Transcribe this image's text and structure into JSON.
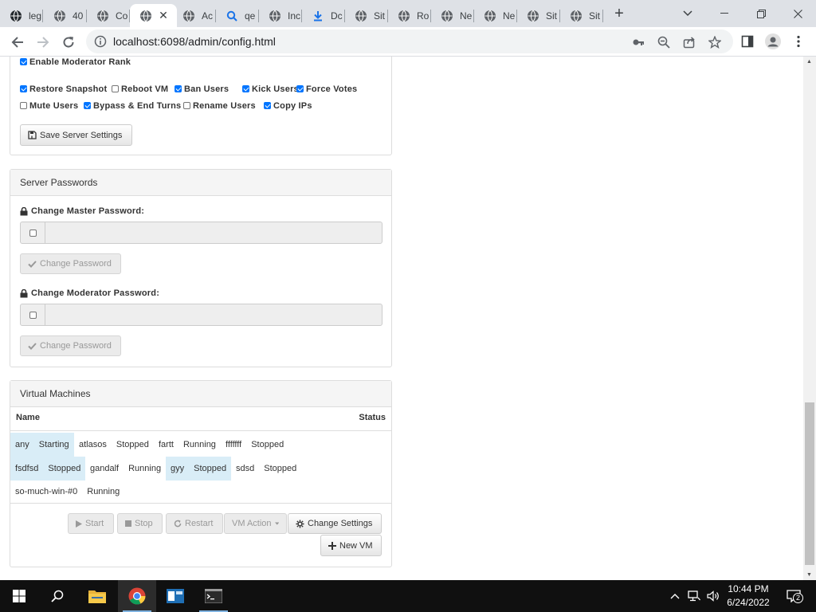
{
  "browser": {
    "tabs": [
      {
        "label": "leg",
        "icon": "github-icon"
      },
      {
        "label": "40",
        "icon": "site-favicon-icon"
      },
      {
        "label": "Co",
        "icon": "globe-icon"
      },
      {
        "label": "",
        "icon": "globe-icon",
        "active": true
      },
      {
        "label": "Ac",
        "icon": "globe-icon"
      },
      {
        "label": "qe",
        "icon": "search-icon"
      },
      {
        "label": "Inc",
        "icon": "site-favicon-icon"
      },
      {
        "label": "Dc",
        "icon": "download-icon"
      },
      {
        "label": "Sit",
        "icon": "globe-icon"
      },
      {
        "label": "Ro",
        "icon": "site-favicon-icon"
      },
      {
        "label": "Ne",
        "icon": "chrome-icon"
      },
      {
        "label": "Ne",
        "icon": "chrome-icon"
      },
      {
        "label": "Sit",
        "icon": "globe-icon"
      },
      {
        "label": "Sit",
        "icon": "globe-icon"
      }
    ],
    "url": "localhost:6098/admin/config.html"
  },
  "permissions": {
    "enable_moderator_rank": {
      "label": "Enable Moderator Rank",
      "checked": true
    },
    "items": [
      {
        "label": "Restore Snapshot",
        "checked": true
      },
      {
        "label": "Reboot VM",
        "checked": false
      },
      {
        "label": "Ban Users",
        "checked": true
      },
      {
        "label": "Kick Users",
        "checked": true
      },
      {
        "label": "Force Votes",
        "checked": true
      },
      {
        "label": "Mute Users",
        "checked": false
      },
      {
        "label": "Bypass & End Turns",
        "checked": true
      },
      {
        "label": "Rename Users",
        "checked": false
      },
      {
        "label": "Copy IPs",
        "checked": true
      }
    ],
    "save_label": "Save Server Settings"
  },
  "passwords": {
    "title": "Server Passwords",
    "master_label": "Change Master Password:",
    "moderator_label": "Change Moderator Password:",
    "change_label": "Change Password"
  },
  "vms": {
    "title": "Virtual Machines",
    "col_name": "Name",
    "col_status": "Status",
    "rows": [
      [
        {
          "name": "any",
          "status": "Starting",
          "selected": true
        },
        {
          "name": "atlasos",
          "status": "Stopped"
        },
        {
          "name": "fartt",
          "status": "Running"
        },
        {
          "name": "fffffff",
          "status": "Stopped"
        }
      ],
      [
        {
          "name": "fsdfsd",
          "status": "Stopped",
          "selected": true
        },
        {
          "name": "gandalf",
          "status": "Running"
        },
        {
          "name": "gyy",
          "status": "Stopped",
          "selected": true
        },
        {
          "name": "sdsd",
          "status": "Stopped"
        }
      ],
      [
        {
          "name": "so-much-win-#0",
          "status": "Running"
        }
      ]
    ],
    "buttons": {
      "start": "Start",
      "stop": "Stop",
      "restart": "Restart",
      "vm_action": "VM Action",
      "change_settings": "Change Settings",
      "new_vm": "New VM"
    }
  },
  "taskbar": {
    "time": "10:44 PM",
    "date": "6/24/2022",
    "notifications": "2"
  }
}
